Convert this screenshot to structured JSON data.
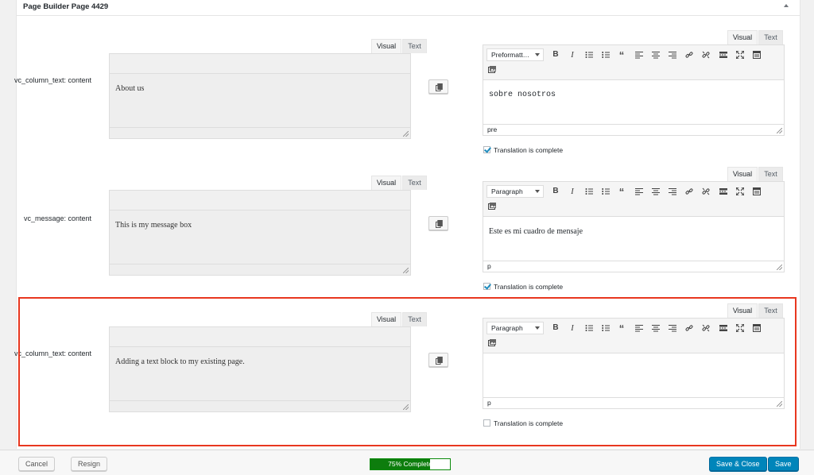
{
  "panel": {
    "title": "Page Builder Page 4429"
  },
  "tabs": {
    "visual": "Visual",
    "text": "Text"
  },
  "rows": [
    {
      "label": "vc_column_text: content",
      "source_text": "About us",
      "format": "Preformatt…",
      "target_text": "sobre nosotros",
      "status_path": "pre",
      "complete_label": "Translation is complete",
      "complete_checked": true
    },
    {
      "label": "vc_message: content",
      "source_text": "This is my message box",
      "format": "Paragraph",
      "target_text": "Este es mi cuadro de mensaje",
      "status_path": "p",
      "complete_label": "Translation is complete",
      "complete_checked": true
    },
    {
      "label": "vc_column_text: content",
      "source_text": "Adding a text block to my existing page.",
      "format": "Paragraph",
      "target_text": "",
      "status_path": "p",
      "complete_label": "Translation is complete",
      "complete_checked": false
    }
  ],
  "toolbar_icons": [
    "bold-icon",
    "italic-icon",
    "bulleted-list-icon",
    "numbered-list-icon",
    "blockquote-icon",
    "align-left-icon",
    "align-center-icon",
    "align-right-icon",
    "insert-link-icon",
    "remove-link-icon",
    "read-more-icon",
    "fullscreen-icon",
    "toolbar-toggle-icon",
    "add-media-icon"
  ],
  "footer": {
    "cancel": "Cancel",
    "resign": "Resign",
    "progress_text": "75% Complete",
    "progress_value": 0.75,
    "save_close": "Save & Close",
    "save": "Save"
  },
  "colors": {
    "accent": "#0085ba",
    "highlight": "#e8371f",
    "progress": "#0d7d0d"
  }
}
